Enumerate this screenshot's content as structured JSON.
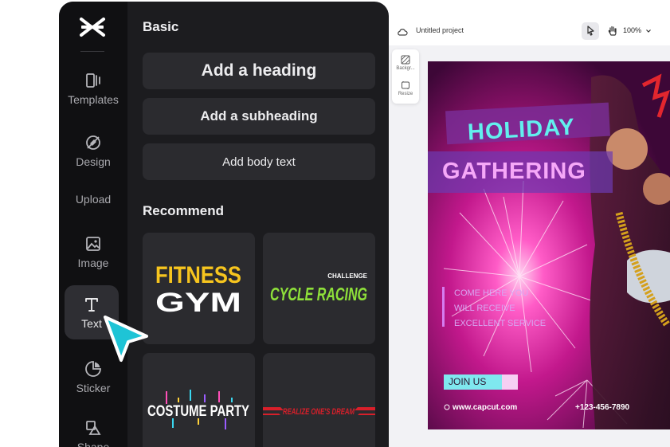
{
  "sidebar": {
    "items": [
      {
        "label": "Templates",
        "icon": "templates-icon"
      },
      {
        "label": "Design",
        "icon": "design-icon"
      },
      {
        "label": "Upload",
        "icon": "upload-icon"
      },
      {
        "label": "Image",
        "icon": "image-icon"
      },
      {
        "label": "Text",
        "icon": "text-icon",
        "active": true
      },
      {
        "label": "Sticker",
        "icon": "sticker-icon"
      },
      {
        "label": "Shape",
        "icon": "shape-icon"
      }
    ]
  },
  "text_panel": {
    "basic_title": "Basic",
    "add_heading": "Add a heading",
    "add_subheading": "Add a subheading",
    "add_body": "Add body text",
    "recommend_title": "Recommend",
    "presets": [
      {
        "line1": "FITNESS",
        "line2": "GYM"
      },
      {
        "small": "CHALLENGE",
        "main": "CYCLE RACING"
      },
      {
        "main": "COSTUME PARTY"
      },
      {
        "main": "REALIZE ONE'S DREAM"
      }
    ]
  },
  "editor": {
    "project_name": "Untitled project",
    "zoom": "100%",
    "floating_tools": [
      {
        "label": "Backgr...",
        "icon": "background-icon"
      },
      {
        "label": "Resize",
        "icon": "resize-icon"
      }
    ]
  },
  "poster": {
    "title_line1": "HOLIDAY",
    "title_line2": "GATHERING",
    "body_lines": [
      "COME HERE YOU",
      "WILL RECEIVE",
      "EXCELLENT SERVICE"
    ],
    "cta": "JOIN US",
    "website": "www.capcut.com",
    "phone": "+123-456-7890"
  },
  "colors": {
    "accent_cyan": "#1ac8d8",
    "poster_magenta": "#c2188c",
    "panel_bg": "#1c1c1f"
  }
}
